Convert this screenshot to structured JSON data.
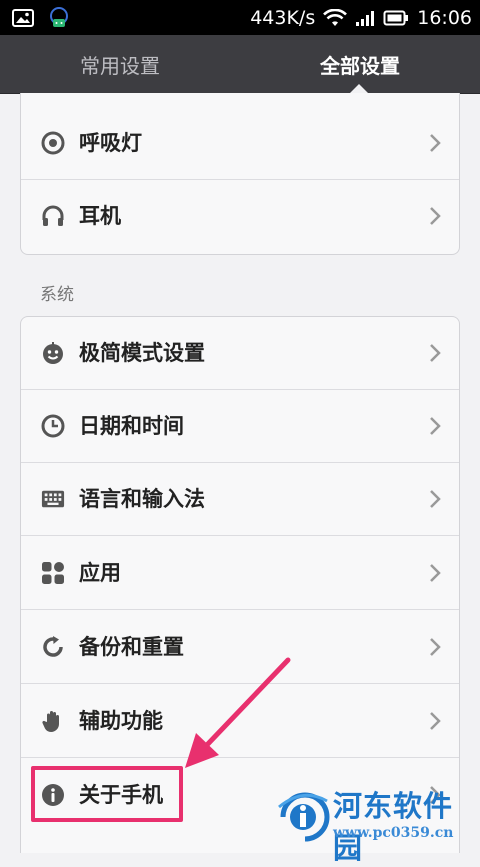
{
  "status_bar": {
    "net_speed": "443K/s",
    "time": "16:06",
    "icons": [
      "image-icon",
      "notification-app-icon",
      "wifi-icon",
      "signal-icon",
      "battery-icon"
    ]
  },
  "tabs": [
    {
      "label": "常用设置",
      "active": false
    },
    {
      "label": "全部设置",
      "active": true
    }
  ],
  "top_group": {
    "items": [
      {
        "label": "呼吸灯",
        "icon": "breathing-light-icon"
      },
      {
        "label": "耳机",
        "icon": "headphones-icon"
      }
    ]
  },
  "system_section": {
    "title": "系统",
    "items": [
      {
        "label": "极简模式设置",
        "icon": "smiley-icon"
      },
      {
        "label": "日期和时间",
        "icon": "clock-icon"
      },
      {
        "label": "语言和输入法",
        "icon": "keyboard-icon"
      },
      {
        "label": "应用",
        "icon": "apps-icon"
      },
      {
        "label": "备份和重置",
        "icon": "backup-icon"
      },
      {
        "label": "辅助功能",
        "icon": "hand-icon"
      },
      {
        "label": "关于手机",
        "icon": "info-icon",
        "highlighted": true
      }
    ]
  },
  "annotation": {
    "color": "#e8306e"
  },
  "watermark": {
    "title": "河东软件园",
    "url": "www.pc0359.cn"
  }
}
